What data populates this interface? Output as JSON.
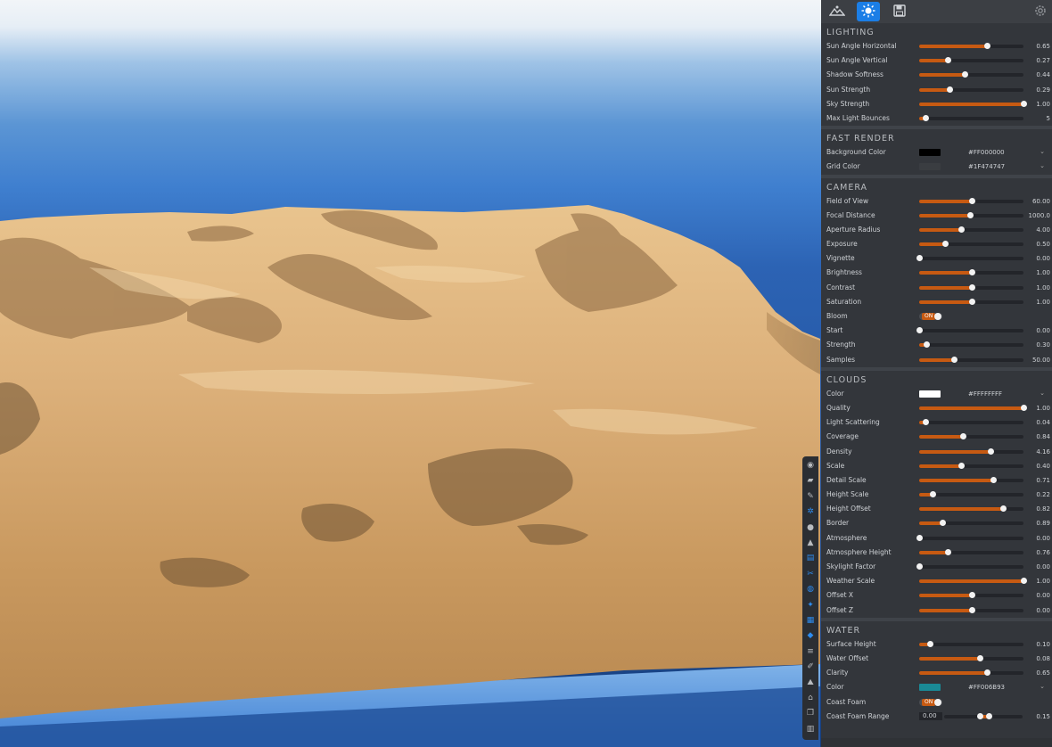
{
  "toolbar": {
    "icons": [
      "terrain-icon",
      "sun-icon",
      "save-icon",
      "settings-gear-icon"
    ],
    "active": "sun-icon"
  },
  "lighting": {
    "title": "LIGHTING",
    "rows": [
      {
        "label": "Sun Angle Horizontal",
        "value": "0.65",
        "fraction": 0.65
      },
      {
        "label": "Sun Angle Vertical",
        "value": "0.27",
        "fraction": 0.27
      },
      {
        "label": "Shadow Softness",
        "value": "0.44",
        "fraction": 0.44
      },
      {
        "label": "Sun Strength",
        "value": "0.29",
        "fraction": 0.29
      },
      {
        "label": "Sky Strength",
        "value": "1.00",
        "fraction": 1.0
      },
      {
        "label": "Max Light Bounces",
        "value": "5",
        "fraction": 0.06
      }
    ]
  },
  "fast_render": {
    "title": "FAST RENDER",
    "background_color": {
      "label": "Background Color",
      "value": "#FF000000",
      "swatch": "#000000"
    },
    "grid_color": {
      "label": "Grid Color",
      "value": "#1F474747",
      "swatch": "#3a3d41"
    }
  },
  "camera": {
    "title": "CAMERA",
    "rows": [
      {
        "label": "Field of View",
        "value": "60.00",
        "fraction": 0.5
      },
      {
        "label": "Focal Distance",
        "value": "1000.0",
        "fraction": 0.49
      },
      {
        "label": "Aperture Radius",
        "value": "4.00",
        "fraction": 0.4
      },
      {
        "label": "Exposure",
        "value": "0.50",
        "fraction": 0.25
      },
      {
        "label": "Vignette",
        "value": "0.00",
        "fraction": 0.0
      },
      {
        "label": "Brightness",
        "value": "1.00",
        "fraction": 0.5
      },
      {
        "label": "Contrast",
        "value": "1.00",
        "fraction": 0.5
      },
      {
        "label": "Saturation",
        "value": "1.00",
        "fraction": 0.5
      }
    ],
    "bloom": {
      "label": "Bloom",
      "state": "ON"
    },
    "rows2": [
      {
        "label": "Start",
        "value": "0.00",
        "fraction": 0.0
      },
      {
        "label": "Strength",
        "value": "0.30",
        "fraction": 0.07
      },
      {
        "label": "Samples",
        "value": "50.00",
        "fraction": 0.33
      }
    ]
  },
  "clouds": {
    "title": "CLOUDS",
    "color": {
      "label": "Color",
      "value": "#FFFFFFFF",
      "swatch": "#ffffff"
    },
    "rows": [
      {
        "label": "Quality",
        "value": "1.00",
        "fraction": 1.0
      },
      {
        "label": "Light Scattering",
        "value": "0.04",
        "fraction": 0.06
      },
      {
        "label": "Coverage",
        "value": "0.84",
        "fraction": 0.42
      },
      {
        "label": "Density",
        "value": "4.16",
        "fraction": 0.68
      },
      {
        "label": "Scale",
        "value": "0.40",
        "fraction": 0.4
      },
      {
        "label": "Detail Scale",
        "value": "0.71",
        "fraction": 0.71
      },
      {
        "label": "Height Scale",
        "value": "0.22",
        "fraction": 0.13
      },
      {
        "label": "Height Offset",
        "value": "0.82",
        "fraction": 0.8
      },
      {
        "label": "Border",
        "value": "0.89",
        "fraction": 0.22
      },
      {
        "label": "Atmosphere",
        "value": "0.00",
        "fraction": 0.0
      },
      {
        "label": "Atmosphere Height",
        "value": "0.76",
        "fraction": 0.27
      },
      {
        "label": "Skylight Factor",
        "value": "0.00",
        "fraction": 0.0
      },
      {
        "label": "Weather Scale",
        "value": "1.00",
        "fraction": 1.0
      },
      {
        "label": "Offset X",
        "value": "0.00",
        "fraction": 0.5
      },
      {
        "label": "Offset Z",
        "value": "0.00",
        "fraction": 0.5
      }
    ]
  },
  "water": {
    "title": "WATER",
    "rows": [
      {
        "label": "Surface Height",
        "value": "0.10",
        "fraction": 0.1
      },
      {
        "label": "Water Offset",
        "value": "0.08",
        "fraction": 0.58
      },
      {
        "label": "Clarity",
        "value": "0.65",
        "fraction": 0.65
      }
    ],
    "color": {
      "label": "Color",
      "value": "#FF006B93",
      "swatch": "#1a8a96"
    },
    "coast_foam": {
      "label": "Coast Foam",
      "state": "ON"
    },
    "coast_foam_range": {
      "label": "Coast Foam Range",
      "min": "0.00",
      "max": "0.15"
    }
  },
  "toolstrip": {
    "icons": [
      "target-icon",
      "folder-icon",
      "brush-icon",
      "gear-icon",
      "drop-icon",
      "mountain-icon",
      "layers-icon",
      "wrench-icon",
      "globe-icon",
      "sparkle-icon",
      "stack-icon",
      "tag-icon",
      "lines-icon",
      "pen-icon",
      "terrain-icon",
      "house-icon",
      "copy-icon",
      "chart-icon"
    ]
  }
}
